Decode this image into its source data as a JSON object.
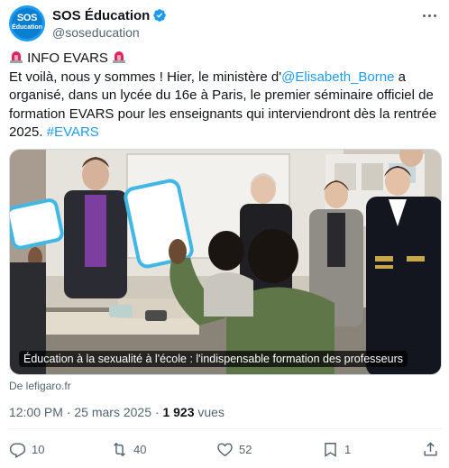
{
  "account": {
    "avatar_line1": "SOS",
    "avatar_line2": "Éducation",
    "display_name": "SOS Éducation",
    "handle": "@soseducation"
  },
  "tweet": {
    "line1_text": "INFO EVARS",
    "line2_before": "Et voilà, nous y sommes ! Hier, le ministère d'",
    "line2_mention": "@Elisabeth_Borne",
    "line2_after": " a",
    "line3": "organisé, dans un lycée du 16e à Paris, le premier séminaire officiel de",
    "line4": "formation EVARS pour les enseignants qui interviendront dès la rentrée",
    "line5_before": "2025. ",
    "line5_hashtag": "#EVARS"
  },
  "media": {
    "caption": "Éducation à la sexualité à l'école : l'indispensable formation des professeurs",
    "source": "De lefigaro.fr"
  },
  "meta": {
    "time": "12:00 PM",
    "separator": " · ",
    "date": "25 mars 2025",
    "views_count": "1 923",
    "views_label": " vues"
  },
  "actions": {
    "replies": "10",
    "reposts": "40",
    "likes": "52",
    "bookmarks": "1"
  },
  "icons": {
    "verified": "verified-badge-icon",
    "siren": "police-light-icon",
    "reply": "reply-icon",
    "repost": "repost-icon",
    "like": "heart-icon",
    "bookmark": "bookmark-icon",
    "share": "share-icon",
    "more": "more-icon"
  },
  "colors": {
    "accent": "#1d9bf0",
    "text": "#0f1419",
    "muted": "#536471",
    "siren": "#e0245e"
  }
}
